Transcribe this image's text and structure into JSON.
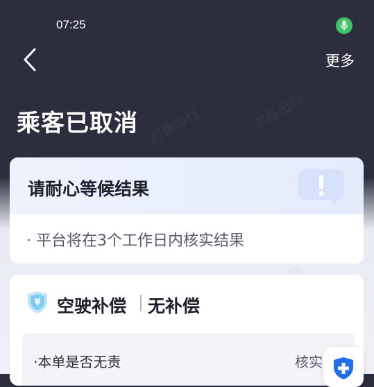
{
  "status_bar": {
    "time": "07:25"
  },
  "nav": {
    "back_icon": "chevron-left-icon",
    "more_label": "更多"
  },
  "page": {
    "title": "乘客已取消"
  },
  "result_card": {
    "heading": "请耐心等候结果",
    "note": "· 平台将在3个工作日内核实结果",
    "icon": "exclamation-bubble-icon"
  },
  "compensation_card": {
    "icon": "yuan-shield-icon",
    "label": "空驶补偿",
    "value": "无补偿",
    "detail": {
      "label": "·本单是否无责",
      "value": "核实"
    }
  },
  "float_button": {
    "icon": "shield-plus-icon"
  },
  "watermark_text": "刘备出行",
  "colors": {
    "header_bg": "#2c2e3e",
    "mic_green": "#3cc466",
    "accent_blue": "#1f6fea",
    "alert_bubble": "#d6e2fb"
  }
}
